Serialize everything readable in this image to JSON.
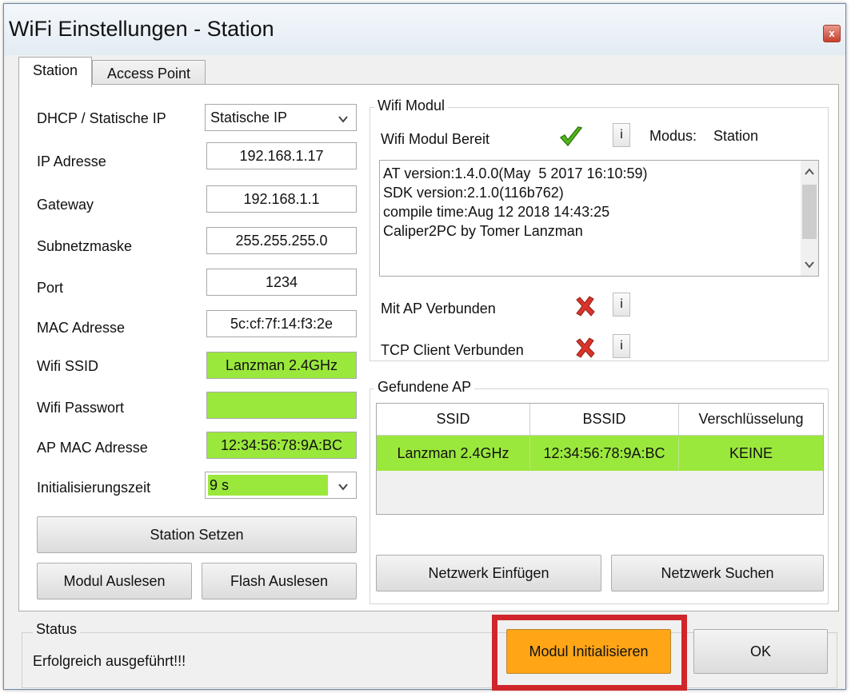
{
  "window": {
    "title": "WiFi Einstellungen - Station",
    "close_glyph": "x"
  },
  "tabs": [
    {
      "label": "Station",
      "active": true
    },
    {
      "label": "Access Point",
      "active": false
    }
  ],
  "station": {
    "dhcp": {
      "label": "DHCP / Statische IP",
      "value": "Statische IP"
    },
    "ip": {
      "label": "IP Adresse",
      "value": "192.168.1.17"
    },
    "gateway": {
      "label": "Gateway",
      "value": "192.168.1.1"
    },
    "subnet": {
      "label": "Subnetzmaske",
      "value": "255.255.255.0"
    },
    "port": {
      "label": "Port",
      "value": "1234"
    },
    "mac": {
      "label": "MAC Adresse",
      "value": "5c:cf:7f:14:f3:2e"
    },
    "ssid": {
      "label": "Wifi SSID",
      "value": "Lanzman 2.4GHz"
    },
    "password": {
      "label": "Wifi Passwort",
      "value": ""
    },
    "ap_mac": {
      "label": "AP MAC Adresse",
      "value": "12:34:56:78:9A:BC"
    },
    "init_time": {
      "label": "Initialisierungszeit",
      "value": "9 s"
    },
    "btn_station_setzen": "Station Setzen",
    "btn_modul_auslesen": "Modul Auslesen",
    "btn_flash_auslesen": "Flash Auslesen"
  },
  "wifi_modul": {
    "group_title": "Wifi Modul",
    "ready_label": "Wifi Modul Bereit",
    "info_glyph": "i",
    "modus_label": "Modus:",
    "modus_value": "Station",
    "log_lines": [
      "AT version:1.4.0.0(May  5 2017 16:10:59)",
      "SDK version:2.1.0(116b762)",
      "compile time:Aug 12 2018 14:43:25",
      "Caliper2PC by Tomer Lanzman"
    ],
    "ap_connected_label": "Mit AP Verbunden",
    "tcp_connected_label": "TCP Client Verbunden"
  },
  "found_ap": {
    "group_title": "Gefundene AP",
    "columns": [
      "SSID",
      "BSSID",
      "Verschlüsselung"
    ],
    "rows": [
      [
        "Lanzman 2.4GHz",
        "12:34:56:78:9A:BC",
        "KEINE"
      ]
    ],
    "btn_insert": "Netzwerk Einfügen",
    "btn_search": "Netzwerk Suchen"
  },
  "status": {
    "group_title": "Status",
    "message": "Erfolgreich ausgeführt!!!"
  },
  "footer": {
    "btn_init": "Modul Initialisieren",
    "btn_ok": "OK"
  },
  "colors": {
    "green_field": "#9be83c",
    "init_button": "#ffa516",
    "highlight_border": "#d0262b"
  },
  "icons": {
    "ready": "green-check-icon",
    "ap_status": "red-x-icon",
    "tcp_status": "red-x-icon"
  }
}
